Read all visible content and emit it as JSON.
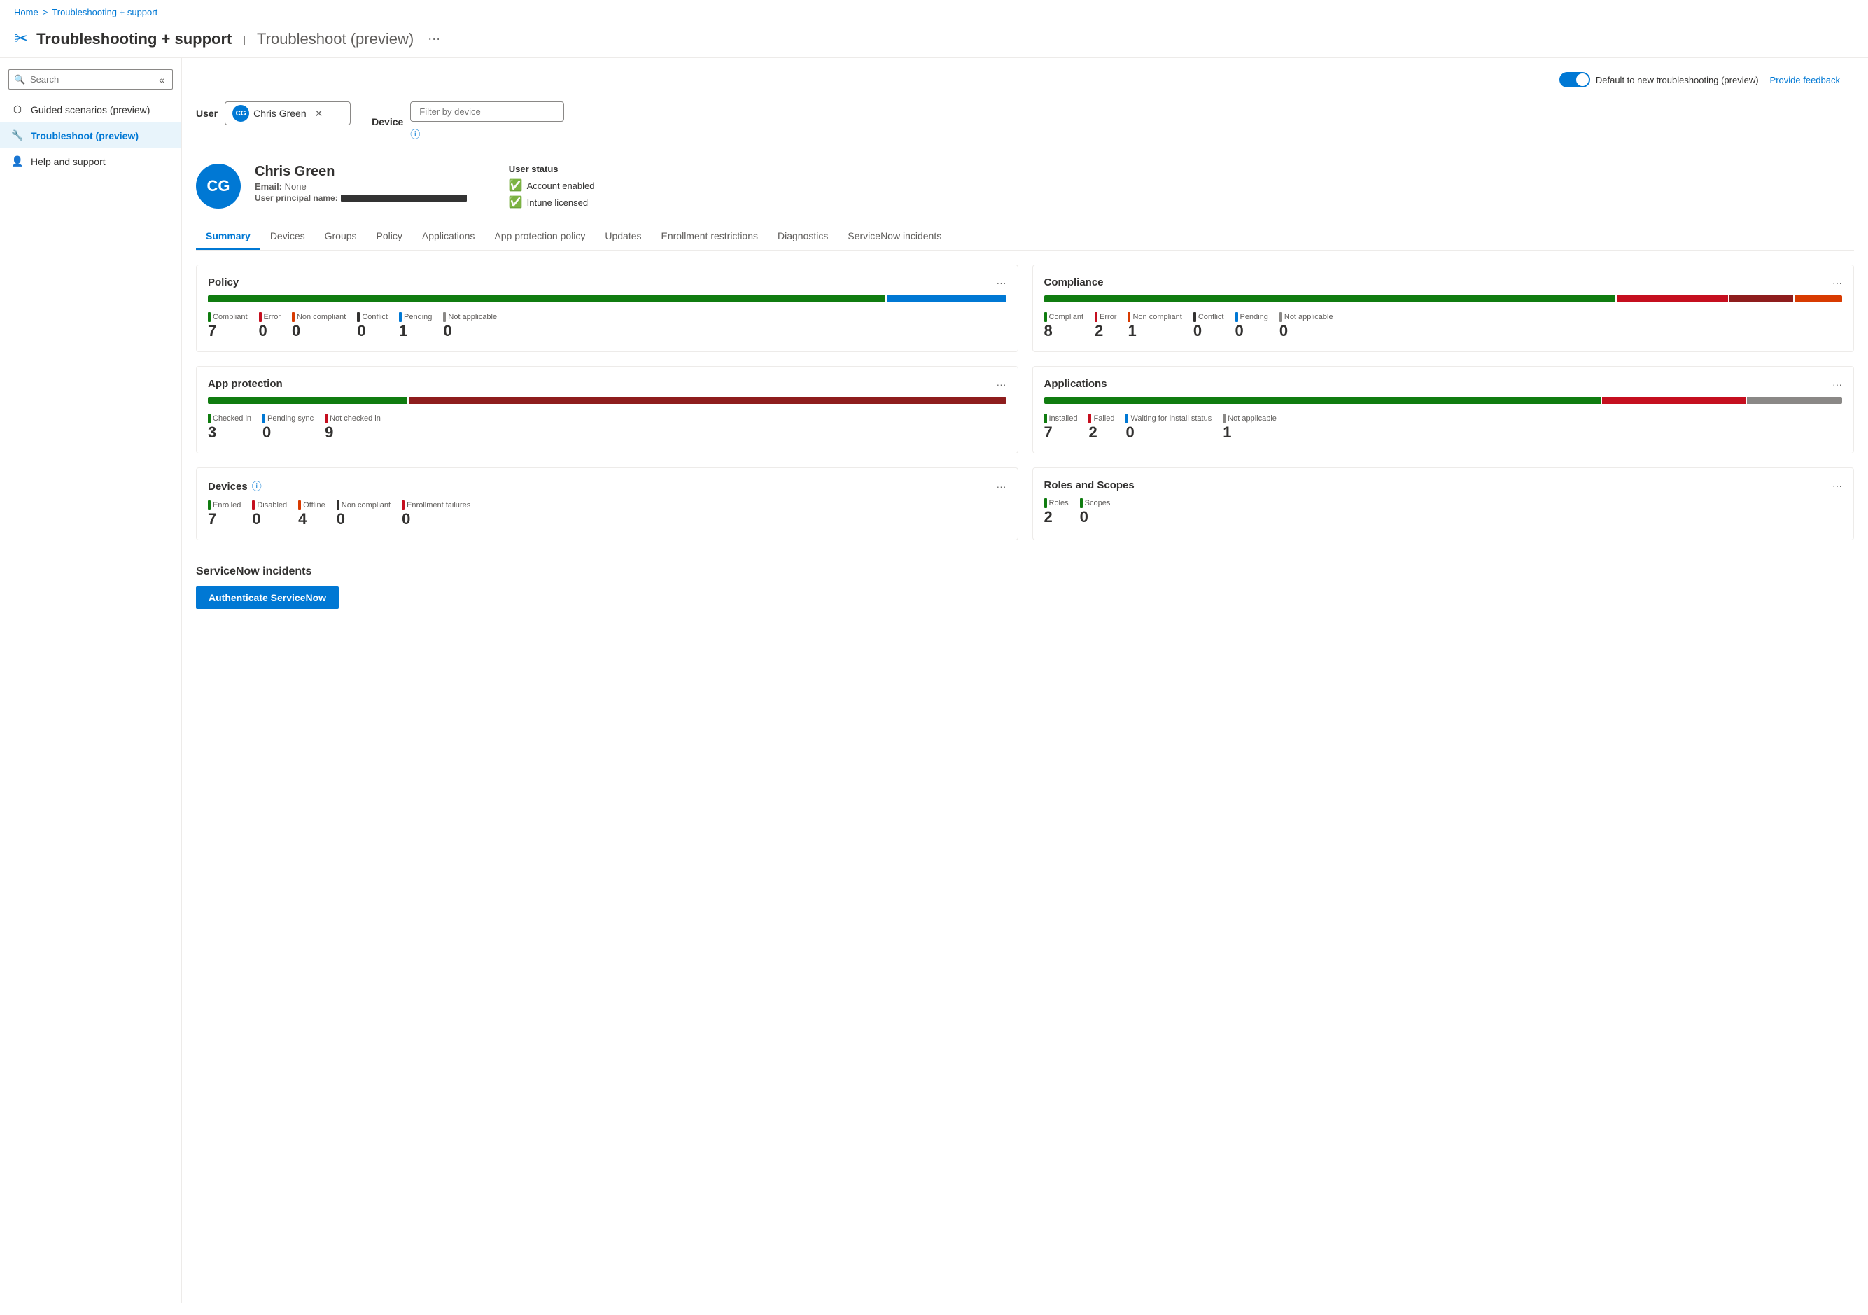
{
  "breadcrumb": {
    "home": "Home",
    "separator": ">",
    "current": "Troubleshooting + support"
  },
  "page_header": {
    "icon": "🔧",
    "title": "Troubleshooting + support",
    "separator": "|",
    "subtitle": "Troubleshoot (preview)",
    "ellipsis": "···"
  },
  "topbar": {
    "toggle_label": "Default to new troubleshooting (preview)",
    "provide_feedback": "Provide feedback"
  },
  "sidebar": {
    "search_placeholder": "Search",
    "items": [
      {
        "id": "guided-scenarios",
        "label": "Guided scenarios (preview)",
        "icon": "⬡"
      },
      {
        "id": "troubleshoot",
        "label": "Troubleshoot (preview)",
        "icon": "🔧",
        "active": true
      },
      {
        "id": "help-support",
        "label": "Help and support",
        "icon": "👤"
      }
    ]
  },
  "filters": {
    "user_label": "User",
    "user_name": "Chris Green",
    "user_initials": "CG",
    "device_label": "Device",
    "device_placeholder": "Filter by device"
  },
  "user_profile": {
    "initials": "CG",
    "name": "Chris Green",
    "email_label": "Email",
    "email_value": "None",
    "upn_label": "User principal name",
    "upn_redacted": true
  },
  "user_status": {
    "title": "User status",
    "items": [
      {
        "label": "Account enabled",
        "status": "ok"
      },
      {
        "label": "Intune licensed",
        "status": "ok"
      }
    ]
  },
  "tabs": [
    {
      "id": "summary",
      "label": "Summary",
      "active": true
    },
    {
      "id": "devices",
      "label": "Devices"
    },
    {
      "id": "groups",
      "label": "Groups"
    },
    {
      "id": "policy",
      "label": "Policy"
    },
    {
      "id": "applications",
      "label": "Applications"
    },
    {
      "id": "app-protection-policy",
      "label": "App protection policy"
    },
    {
      "id": "updates",
      "label": "Updates"
    },
    {
      "id": "enrollment-restrictions",
      "label": "Enrollment restrictions"
    },
    {
      "id": "diagnostics",
      "label": "Diagnostics"
    },
    {
      "id": "servicenow-incidents",
      "label": "ServiceNow incidents"
    }
  ],
  "cards": {
    "policy": {
      "title": "Policy",
      "bar": [
        {
          "color": "#107c10",
          "width": 85
        },
        {
          "color": "#0078d4",
          "width": 15
        }
      ],
      "stats": [
        {
          "label": "Compliant",
          "value": "7",
          "color": "green"
        },
        {
          "label": "Error",
          "value": "0",
          "color": "red"
        },
        {
          "label": "Non compliant",
          "value": "0",
          "color": "orange"
        },
        {
          "label": "Conflict",
          "value": "0",
          "color": "black"
        },
        {
          "label": "Pending",
          "value": "1",
          "color": "blue"
        },
        {
          "label": "Not applicable",
          "value": "0",
          "color": "gray"
        }
      ]
    },
    "compliance": {
      "title": "Compliance",
      "bar": [
        {
          "color": "#107c10",
          "width": 72
        },
        {
          "color": "#c50f1f",
          "width": 14
        },
        {
          "color": "#8e1d1d",
          "width": 8
        },
        {
          "color": "#d83b01",
          "width": 6
        }
      ],
      "stats": [
        {
          "label": "Compliant",
          "value": "8",
          "color": "green"
        },
        {
          "label": "Error",
          "value": "2",
          "color": "red"
        },
        {
          "label": "Non compliant",
          "value": "1",
          "color": "orange"
        },
        {
          "label": "Conflict",
          "value": "0",
          "color": "black"
        },
        {
          "label": "Pending",
          "value": "0",
          "color": "blue"
        },
        {
          "label": "Not applicable",
          "value": "0",
          "color": "gray"
        }
      ]
    },
    "app_protection": {
      "title": "App protection",
      "bar": [
        {
          "color": "#107c10",
          "width": 25
        },
        {
          "color": "#8e1d1d",
          "width": 75
        }
      ],
      "stats": [
        {
          "label": "Checked in",
          "value": "3",
          "color": "green"
        },
        {
          "label": "Pending sync",
          "value": "0",
          "color": "blue"
        },
        {
          "label": "Not checked in",
          "value": "9",
          "color": "red"
        }
      ]
    },
    "applications": {
      "title": "Applications",
      "bar": [
        {
          "color": "#107c10",
          "width": 70
        },
        {
          "color": "#c50f1f",
          "width": 18
        },
        {
          "color": "#8a8886",
          "width": 12
        }
      ],
      "stats": [
        {
          "label": "Installed",
          "value": "7",
          "color": "green"
        },
        {
          "label": "Failed",
          "value": "2",
          "color": "red"
        },
        {
          "label": "Waiting for install status",
          "value": "0",
          "color": "blue"
        },
        {
          "label": "Not applicable",
          "value": "1",
          "color": "gray"
        }
      ]
    },
    "devices": {
      "title": "Devices",
      "info_icon": true,
      "stats": [
        {
          "label": "Enrolled",
          "value": "7",
          "color": "green"
        },
        {
          "label": "Disabled",
          "value": "0",
          "color": "red"
        },
        {
          "label": "Offline",
          "value": "4",
          "color": "orange"
        },
        {
          "label": "Non compliant",
          "value": "0",
          "color": "black"
        },
        {
          "label": "Enrollment failures",
          "value": "0",
          "color": "red"
        }
      ]
    },
    "roles_scopes": {
      "title": "Roles and Scopes",
      "stats": [
        {
          "label": "Roles",
          "value": "2",
          "color": "green"
        },
        {
          "label": "Scopes",
          "value": "0",
          "color": "green"
        }
      ]
    }
  },
  "servicenow": {
    "title": "ServiceNow incidents",
    "button_label": "Authenticate ServiceNow"
  }
}
